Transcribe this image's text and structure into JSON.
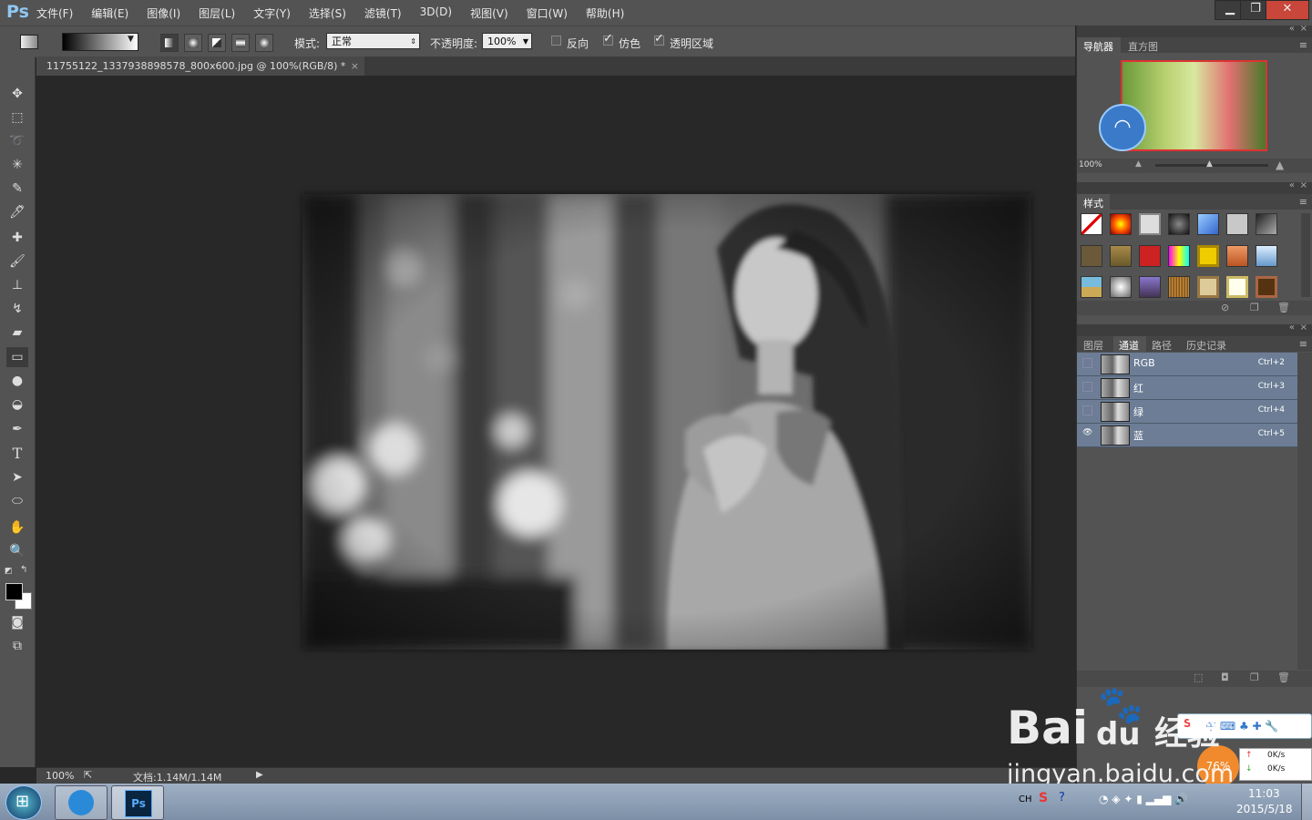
{
  "app": {
    "logo": "Ps"
  },
  "menu": [
    "文件(F)",
    "编辑(E)",
    "图像(I)",
    "图层(L)",
    "文字(Y)",
    "选择(S)",
    "滤镜(T)",
    "3D(D)",
    "视图(V)",
    "窗口(W)",
    "帮助(H)"
  ],
  "window_controls": {
    "minimize": "▁",
    "restore": "❐",
    "close": "✕"
  },
  "options": {
    "mode_label": "模式:",
    "mode_value": "正常",
    "opacity_label": "不透明度:",
    "opacity_value": "100%",
    "reverse_label": "反向",
    "dither_label": "仿色",
    "transparency_label": "透明区域",
    "reverse_checked": false,
    "dither_checked": true,
    "transparency_checked": true
  },
  "document": {
    "tab_title": "11755122_1337938898578_800x600.jpg @ 100%(RGB/8) *",
    "close": "×"
  },
  "status": {
    "zoom": "100%",
    "doc_info": "文档:1.14M/1.14M"
  },
  "navigator": {
    "tab_navigator": "导航器",
    "tab_histogram": "直方图",
    "zoom": "100%"
  },
  "styles": {
    "tab": "样式"
  },
  "channels_panel": {
    "tabs": [
      "图层",
      "通道",
      "路径",
      "历史记录"
    ],
    "rows": [
      {
        "name": "RGB",
        "shortcut": "Ctrl+2",
        "visible": false
      },
      {
        "name": "红",
        "shortcut": "Ctrl+3",
        "visible": false
      },
      {
        "name": "绿",
        "shortcut": "Ctrl+4",
        "visible": false
      },
      {
        "name": "蓝",
        "shortcut": "Ctrl+5",
        "visible": true
      }
    ]
  },
  "tray": {
    "lang": "CH",
    "time": "11:03",
    "date": "2015/5/18",
    "net_percent": "76%",
    "up_speed": "0K/s",
    "down_speed": "0K/s"
  },
  "watermark": {
    "brand": "Bai",
    "brand_cn": "经验",
    "url": "jingyan.baidu.com",
    "du": "du"
  },
  "colors": {
    "panel_bg": "#535353",
    "canvas_bg": "#282828",
    "channel_row": "#6c7d95",
    "taskbar": "#8ea0b6"
  }
}
